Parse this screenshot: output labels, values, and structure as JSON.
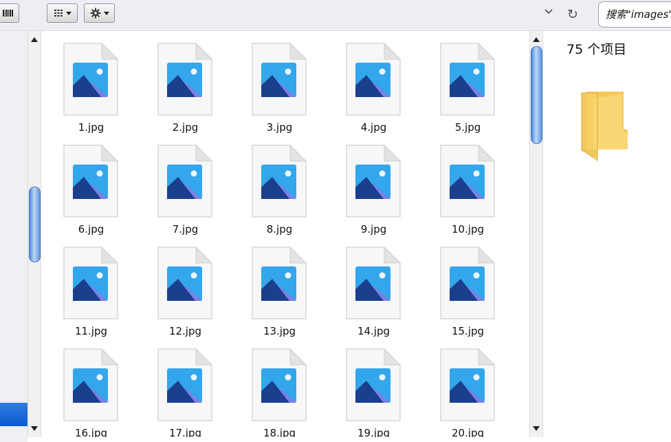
{
  "search": {
    "text": "搜索\"images\""
  },
  "preview": {
    "item_count": "75 个项目"
  },
  "files": [
    "1.jpg",
    "2.jpg",
    "3.jpg",
    "4.jpg",
    "5.jpg",
    "6.jpg",
    "7.jpg",
    "8.jpg",
    "9.jpg",
    "10.jpg",
    "11.jpg",
    "12.jpg",
    "13.jpg",
    "14.jpg",
    "15.jpg",
    "16.jpg",
    "17.jpg",
    "18.jpg",
    "19.jpg",
    "20.jpg"
  ],
  "icons": {
    "toolbar": [
      "barcode-icon",
      "view-grid-icon",
      "gear-icon",
      "chevron-down-icon",
      "refresh-icon"
    ],
    "file": "image-file-icon",
    "preview": "folder-icon"
  },
  "colors": {
    "selection": "#0b5bd1",
    "scroll_thumb": "#4a86d8",
    "folder": "#f5d36b"
  }
}
